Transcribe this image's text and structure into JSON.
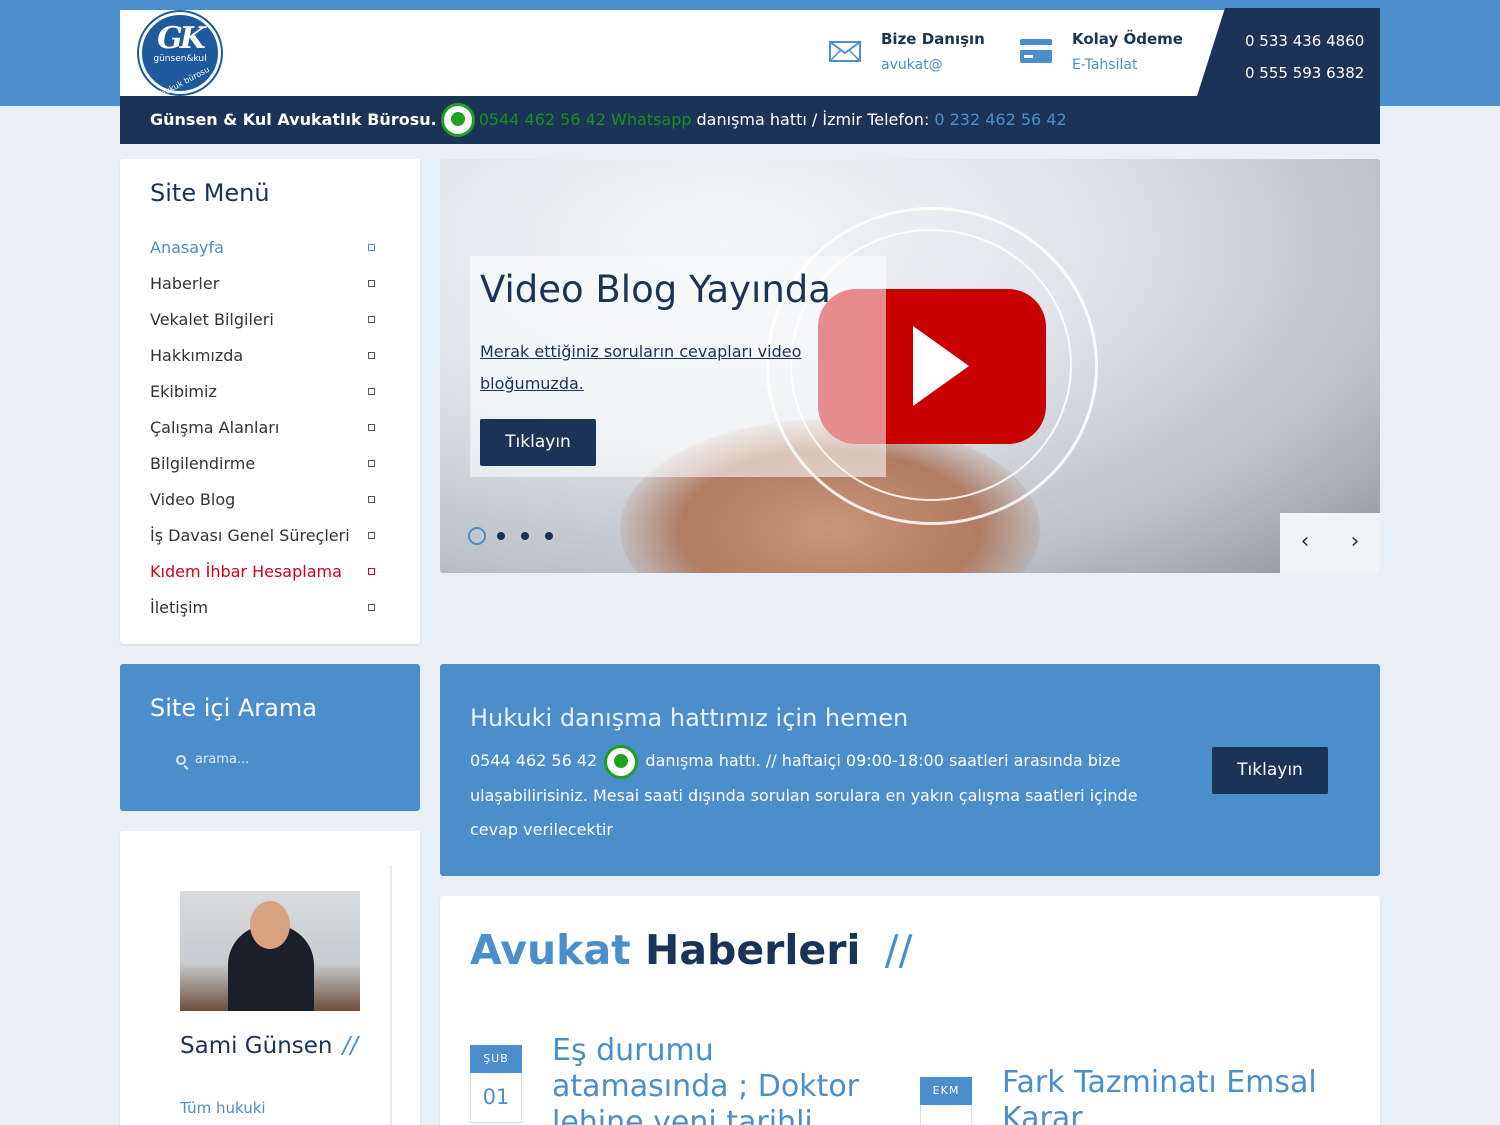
{
  "header": {
    "logo_text": "GK",
    "logo_sub": "günsen&kul",
    "logo_sub2": "hukuk bürosu",
    "consult_title": "Bize Danışın",
    "consult_sub": "avukat@",
    "payment_title": "Kolay Ödeme",
    "payment_sub": "E-Tahsilat",
    "phone1": "0 533 436 4860",
    "phone2": "0 555 593 6382",
    "bar_brand": "Günsen & Kul Avukatlık Bürosu.",
    "bar_whatsapp": "0544 462 56 42 Whatsapp",
    "bar_mid": "danışma hattı / İzmir Telefon:",
    "bar_phone": "0 232 462 56 42"
  },
  "menu": {
    "title": "Site Menü",
    "items": [
      {
        "label": "Anasayfa"
      },
      {
        "label": "Haberler"
      },
      {
        "label": "Vekalet Bilgileri"
      },
      {
        "label": "Hakkımızda"
      },
      {
        "label": "Ekibimiz"
      },
      {
        "label": "Çalışma Alanları"
      },
      {
        "label": "Bilgilendirme"
      },
      {
        "label": "Video Blog"
      },
      {
        "label": "İş Davası Genel Süreçleri"
      },
      {
        "label": "Kıdem İhbar Hesaplama"
      },
      {
        "label": "İletişim"
      }
    ]
  },
  "slider": {
    "title": "Video Blog Yayında",
    "text": "Merak ettiğiniz soruların cevapları video bloğumuzda.",
    "button": "Tıklayın",
    "prev": "‹",
    "next": "›"
  },
  "search": {
    "title": "Site içi Arama",
    "placeholder": "arama..."
  },
  "cta": {
    "title": "Hukuki danışma hattımız için hemen",
    "phone": "0544 462 56 42",
    "text": "danışma hattı. // haftaiçi 09:00-18:00 saatleri arasında bize ulaşabilirisiniz. Mesai saati dışında sorulan sorulara en yakın çalışma saatleri içinde cevap verilecektir",
    "button": "Tıklayın"
  },
  "profile": {
    "name": "Sami Günsen",
    "slashes": "//",
    "link": "Tüm hukuki"
  },
  "news": {
    "title_a": "Avukat",
    "title_b": "Haberleri",
    "title_c": "//",
    "items": [
      {
        "month": "ŞUB",
        "day": "01",
        "headline": "Eş durumu atamasında ; Doktor lehine yeni tarihli"
      },
      {
        "month": "EKM",
        "day": "",
        "headline": "Fark Tazminatı Emsal Karar"
      }
    ]
  },
  "colors": {
    "navy": "#1c3358",
    "blue": "#4a8fcb",
    "whatsapp_green": "#1a8f1a",
    "highlight_red": "#d0021b"
  }
}
